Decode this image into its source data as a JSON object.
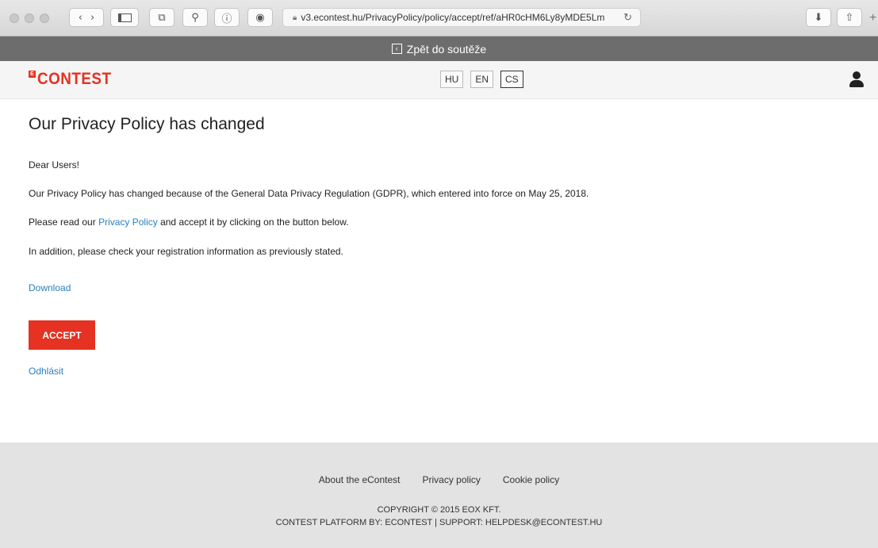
{
  "browser": {
    "url": "v3.econtest.hu/PrivacyPolicy/policy/accept/ref/aHR0cHM6Ly8yMDE5Lm",
    "lock_icon": "lock-icon",
    "reload_icon": "reload-icon"
  },
  "backbar": {
    "label": "Zpět do soutěže"
  },
  "header": {
    "logo_mark": "E",
    "logo_text": "CONTEST",
    "languages": [
      "HU",
      "EN",
      "CS"
    ],
    "active_language": "CS"
  },
  "main": {
    "title": "Our Privacy Policy has changed",
    "greeting": "Dear Users!",
    "paragraph1": "Our Privacy Policy has changed because of the General Data Privacy Regulation (GDPR), which entered into force on May 25, 2018.",
    "paragraph2_prefix": "Please read our ",
    "paragraph2_link": "Privacy Policy",
    "paragraph2_suffix": " and accept it by clicking on the button below.",
    "paragraph3": "In addition, please check your registration information as previously stated.",
    "download_label": "Download",
    "accept_label": "ACCEPT",
    "logout_label": "Odhlásit"
  },
  "footer": {
    "links": [
      "About the eContest",
      "Privacy policy",
      "Cookie policy"
    ],
    "copyright": "COPYRIGHT © 2015 EOX KFT.",
    "platform": "CONTEST PLATFORM BY: ECONTEST | SUPPORT: HELPDESK@ECONTEST.HU"
  },
  "colors": {
    "accent": "#e53223",
    "link": "#2a7fc0",
    "backbar": "#6d6d6d",
    "footer": "#e3e3e3"
  }
}
